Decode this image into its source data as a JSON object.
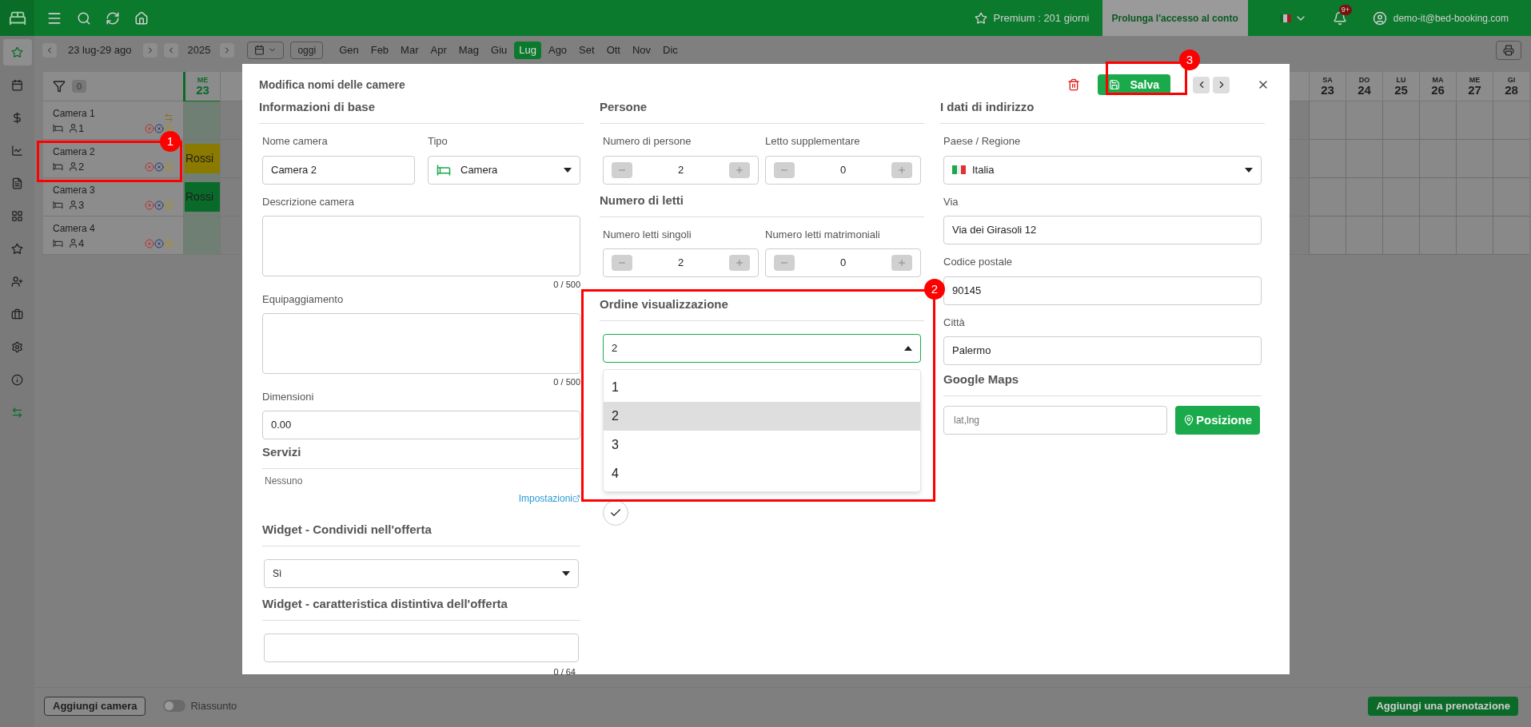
{
  "topbar": {
    "premium": "Premium : 201 giorni",
    "extend_button": "Prolunga l'accesso al conto",
    "notifications_badge": "9+",
    "user": "demo-it@bed-booking.com"
  },
  "sidebar": {
    "items": [
      {
        "selected": true
      },
      {
        "selected": false
      },
      {
        "selected": false
      },
      {
        "selected": false
      },
      {
        "selected": false
      },
      {
        "selected": false
      },
      {
        "selected": false
      },
      {
        "selected": false
      },
      {
        "selected": false
      },
      {
        "selected": false
      },
      {
        "selected": false
      },
      {
        "selected": false
      }
    ]
  },
  "toolbar": {
    "range": "23 lug-29 ago",
    "year": "2025",
    "today": "oggi",
    "months": [
      {
        "label": "Gen",
        "selected": false
      },
      {
        "label": "Feb",
        "selected": false
      },
      {
        "label": "Mar",
        "selected": false
      },
      {
        "label": "Apr",
        "selected": false
      },
      {
        "label": "Mag",
        "selected": false
      },
      {
        "label": "Giu",
        "selected": false
      },
      {
        "label": "Lug",
        "selected": true
      },
      {
        "label": "Ago",
        "selected": false
      },
      {
        "label": "Set",
        "selected": false
      },
      {
        "label": "Ott",
        "selected": false
      },
      {
        "label": "Nov",
        "selected": false
      },
      {
        "label": "Dic",
        "selected": false
      }
    ]
  },
  "calendar": {
    "filter_count": "0",
    "days_left": [
      {
        "weekday": "ME",
        "day": "23",
        "today": true
      }
    ],
    "days_right": [
      {
        "weekday": "SA",
        "day": "23",
        "today": false
      },
      {
        "weekday": "DO",
        "day": "24",
        "today": false
      },
      {
        "weekday": "LU",
        "day": "25",
        "today": false
      },
      {
        "weekday": "MA",
        "day": "26",
        "today": false
      },
      {
        "weekday": "ME",
        "day": "27",
        "today": false
      },
      {
        "weekday": "GI",
        "day": "28",
        "today": false
      }
    ],
    "rooms": [
      {
        "name": "Camera 1",
        "persons": "1",
        "swap_marker": true
      },
      {
        "name": "Camera 2",
        "persons": "2",
        "swap_marker": false,
        "booking": {
          "guest": "Rossi",
          "color": "#8a7a00"
        }
      },
      {
        "name": "Camera 3",
        "persons": "3",
        "swap_marker": false,
        "booking": {
          "guest": "Rossi",
          "color": "#0a6a2a"
        }
      },
      {
        "name": "Camera 4",
        "persons": "4",
        "swap_marker": false
      }
    ]
  },
  "modal": {
    "title": "Modifica nomi delle camere",
    "save": "Salva",
    "basic": {
      "heading": "Informazioni di base",
      "name_label": "Nome camera",
      "name_value": "Camera 2",
      "type_label": "Tipo",
      "type_value": "Camera",
      "description_label": "Descrizione camera",
      "description_counter": "0 / 500",
      "equipment_label": "Equipaggiamento",
      "equipment_counter": "0 / 500",
      "size_label": "Dimensioni",
      "size_value": "0.00"
    },
    "services": {
      "heading": "Servizi",
      "empty": "Nessuno",
      "settings_link": "Impostazioni"
    },
    "widget_share": {
      "heading": "Widget - Condividi nell'offerta",
      "value": "Sì"
    },
    "widget_feature": {
      "heading": "Widget - caratteristica distintiva dell'offerta",
      "counter": "0 / 64"
    },
    "persons": {
      "heading": "Persone",
      "steppers": [
        {
          "label": "Numero di persone",
          "value": "2"
        },
        {
          "label": "Letto supplementare",
          "value": "0"
        }
      ]
    },
    "beds": {
      "heading": "Numero di letti",
      "steppers": [
        {
          "label": "Numero letti singoli",
          "value": "2"
        },
        {
          "label": "Numero letti matrimoniali",
          "value": "0"
        }
      ]
    },
    "order": {
      "heading": "Ordine visualizzazione",
      "value": "2",
      "expanded": true,
      "options": [
        {
          "label": "1",
          "selected": false
        },
        {
          "label": "2",
          "selected": true
        },
        {
          "label": "3",
          "selected": false
        },
        {
          "label": "4",
          "selected": false
        }
      ]
    },
    "address": {
      "heading": "I dati di indirizzo",
      "country_label": "Paese / Regione",
      "country_value": "Italia",
      "street_label": "Via",
      "street_value": "Via dei Girasoli 12",
      "zip_label": "Codice postale",
      "zip_value": "90145",
      "city_label": "Città",
      "city_value": "Palermo"
    },
    "maps": {
      "heading": "Google Maps",
      "placeholder": "lat,lng",
      "button": "Posizione"
    }
  },
  "annotations": [
    {
      "number": "1"
    },
    {
      "number": "2"
    },
    {
      "number": "3"
    }
  ],
  "bottom": {
    "add_room": "Aggiungi camera",
    "summary_toggle": {
      "label": "Riassunto",
      "on": false
    },
    "add_booking": "Aggiungi una prenotazione"
  }
}
